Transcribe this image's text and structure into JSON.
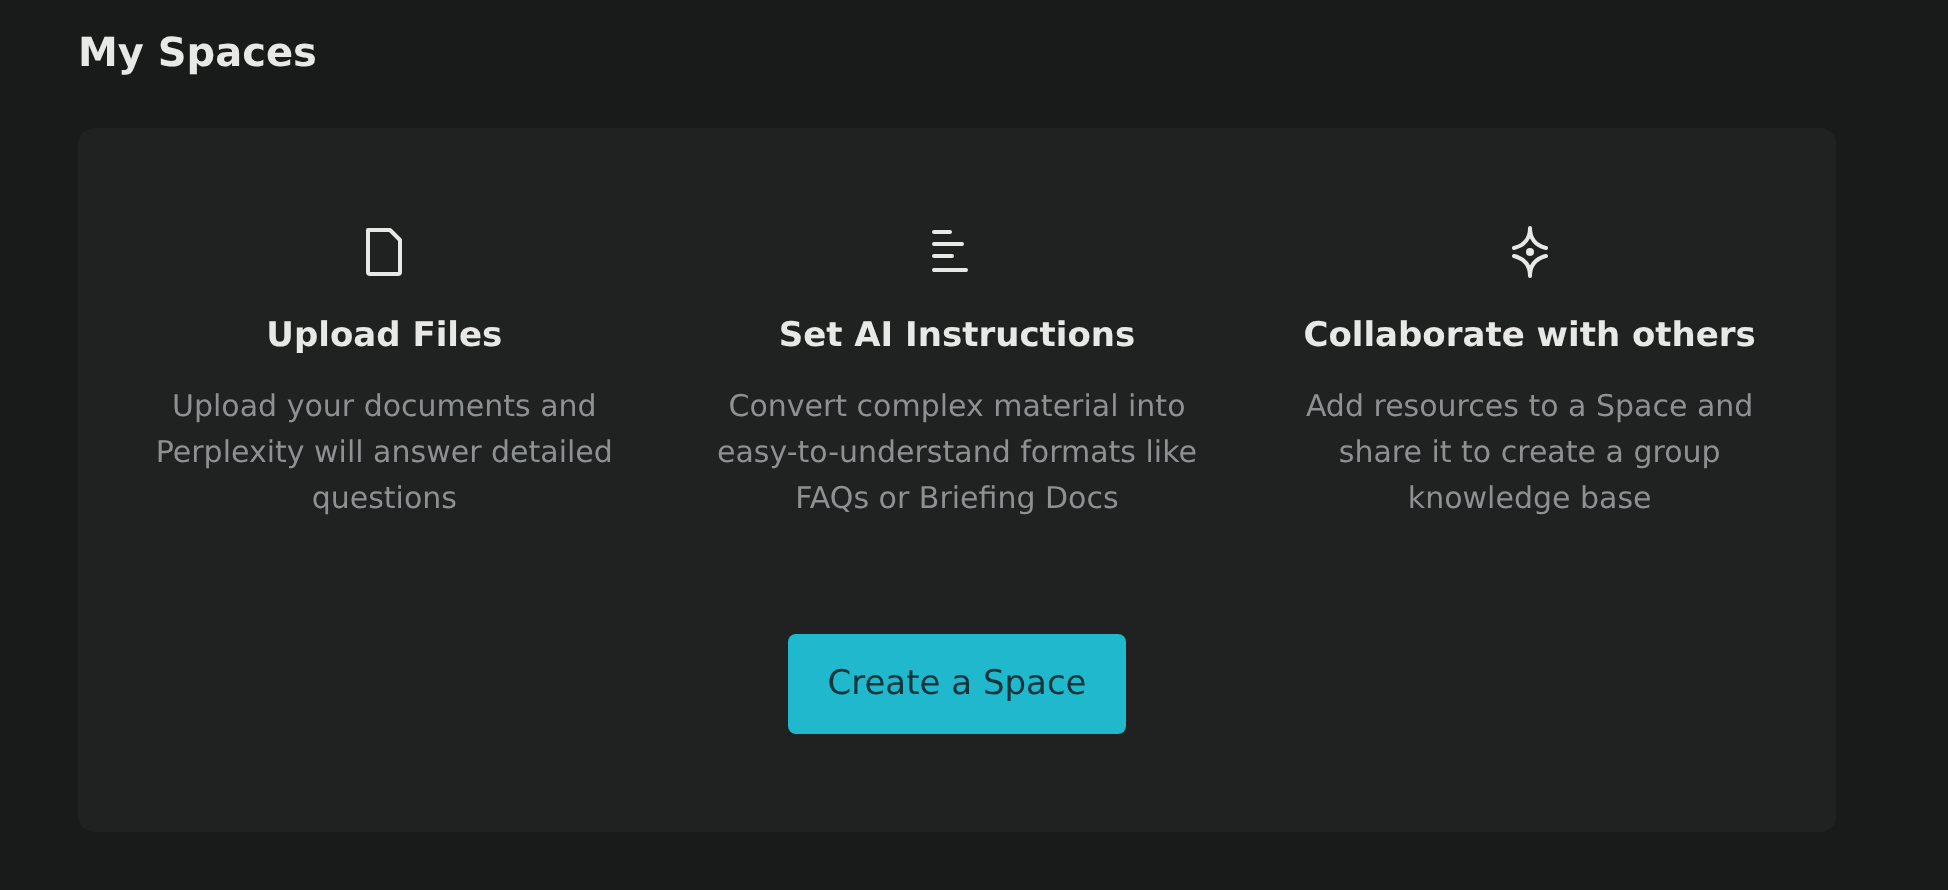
{
  "title": "My Spaces",
  "features": [
    {
      "kind": "file",
      "heading": "Upload Files",
      "description": "Upload your documents and Perplexity will answer detailed questions"
    },
    {
      "kind": "lines",
      "heading": "Set AI Instructions",
      "description": "Convert complex material into easy-to-understand formats like FAQs or Briefing Docs"
    },
    {
      "kind": "sparkle",
      "heading": "Collaborate with others",
      "description": "Add resources to a Space and share it to create a group knowledge base"
    }
  ],
  "button": "Create a Space"
}
